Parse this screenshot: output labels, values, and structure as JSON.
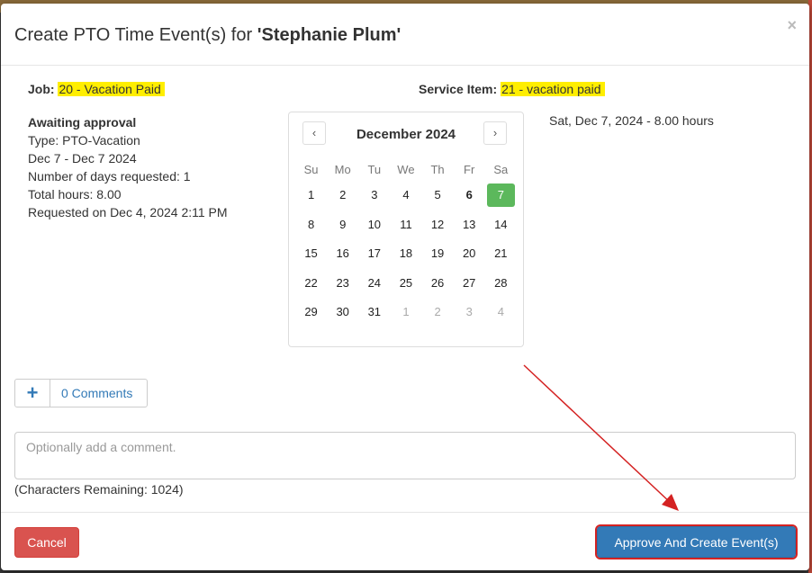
{
  "modal": {
    "title_prefix": "Create PTO Time Event(s) for ",
    "title_name": "'Stephanie Plum'",
    "close_glyph": "×"
  },
  "job": {
    "label": "Job:",
    "value": "20 - Vacation Paid"
  },
  "service_item": {
    "label": "Service Item:",
    "value": "21 - vacation paid"
  },
  "request": {
    "status": "Awaiting approval",
    "type": "Type: PTO-Vacation",
    "range": "Dec 7 - Dec 7 2024",
    "days": "Number of days requested: 1",
    "hours": "Total hours: 8.00",
    "requested_on": "Requested on Dec 4, 2024 2:11 PM"
  },
  "calendar": {
    "title": "December 2024",
    "prev_glyph": "‹",
    "next_glyph": "›",
    "weekdays": [
      "Su",
      "Mo",
      "Tu",
      "We",
      "Th",
      "Fr",
      "Sa"
    ],
    "weeks": [
      [
        "1",
        "2",
        "3",
        "4",
        "5",
        "6",
        "7"
      ],
      [
        "8",
        "9",
        "10",
        "11",
        "12",
        "13",
        "14"
      ],
      [
        "15",
        "16",
        "17",
        "18",
        "19",
        "20",
        "21"
      ],
      [
        "22",
        "23",
        "24",
        "25",
        "26",
        "27",
        "28"
      ],
      [
        "29",
        "30",
        "31",
        "1",
        "2",
        "3",
        "4"
      ]
    ],
    "selected_day": "7",
    "bold_day": "6"
  },
  "summary": "Sat, Dec 7, 2024 - 8.00 hours",
  "comments": {
    "plus_glyph": "+",
    "label": "0 Comments"
  },
  "comment_input": {
    "placeholder": "Optionally add a comment.",
    "value": ""
  },
  "chars_remaining": "(Characters Remaining: 1024)",
  "buttons": {
    "cancel": "Cancel",
    "approve": "Approve And Create Event(s)"
  },
  "colors": {
    "primary": "#337ab7",
    "danger": "#d9534f",
    "success": "#5cb85c",
    "highlight": "#ffee00",
    "annotation": "#d42222"
  }
}
